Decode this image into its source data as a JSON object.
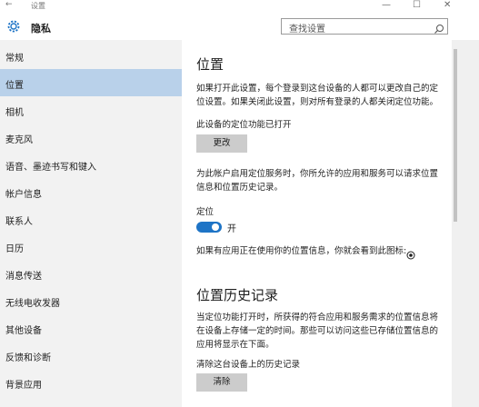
{
  "window": {
    "back_glyph": "←",
    "title": "设置",
    "minimize_glyph": "—",
    "maximize_glyph": "☐",
    "close_glyph": "✕"
  },
  "header": {
    "title": "隐私",
    "search_placeholder": "查找设置"
  },
  "sidebar": {
    "items": [
      {
        "label": "常规"
      },
      {
        "label": "位置",
        "selected": true
      },
      {
        "label": "相机"
      },
      {
        "label": "麦克风"
      },
      {
        "label": "语音、墨迹书写和键入"
      },
      {
        "label": "帐户信息"
      },
      {
        "label": "联系人"
      },
      {
        "label": "日历"
      },
      {
        "label": "消息传送"
      },
      {
        "label": "无线电收发器"
      },
      {
        "label": "其他设备"
      },
      {
        "label": "反馈和诊断"
      },
      {
        "label": "背景应用"
      }
    ]
  },
  "main": {
    "heading": "位置",
    "desc": "如果打开此设置，每个登录到这台设备的人都可以更改自己的定位设置。如果关闭此设置，则对所有登录的人都关闭定位功能。",
    "device_status": "此设备的定位功能已打开",
    "change_button": "更改",
    "account_desc": "为此帐户启用定位服务时，你所允许的应用和服务可以请求位置信息和位置历史记录。",
    "location_label": "定位",
    "toggle_state": "开",
    "toggle_on": true,
    "in_use_text": "如果有应用正在使用你的位置信息，你就会看到此图标:",
    "history_heading": "位置历史记录",
    "history_desc": "当定位功能打开时，所获得的符合应用和服务需求的位置信息将在设备上存储一定的时间。那些可以访问这些已存储位置信息的应用将显示在下面。",
    "clear_label": "清除这台设备上的历史记录",
    "clear_button": "清除"
  },
  "colors": {
    "accent": "#1e74c6",
    "selected_bg": "#b9d1ea",
    "sidebar_bg": "#f2f2f2",
    "button_bg": "#cccccc"
  }
}
